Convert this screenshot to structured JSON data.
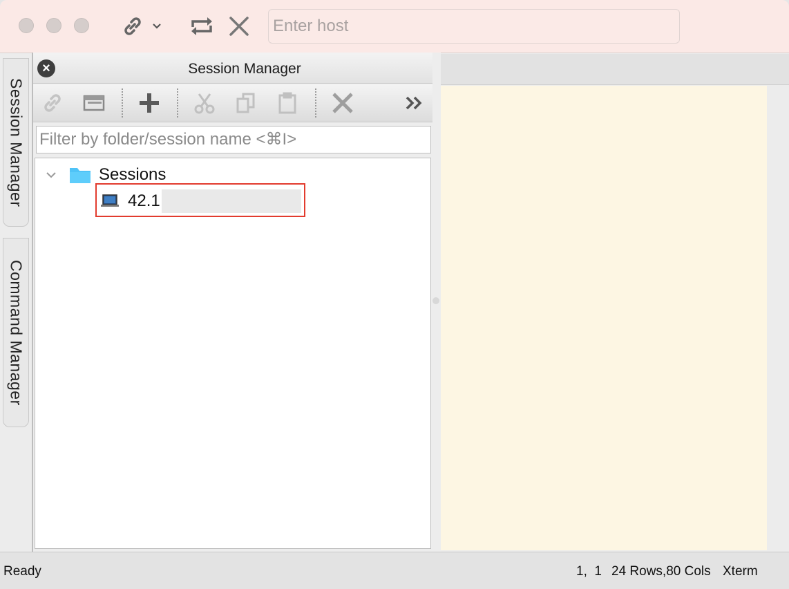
{
  "toolbar": {
    "host_placeholder": "Enter host",
    "icons": [
      "link-icon",
      "chevron-down-icon",
      "reconnect-icon",
      "close-icon"
    ]
  },
  "side_tabs": [
    "Session Manager",
    "Command Manager"
  ],
  "session_manager": {
    "title": "Session Manager",
    "toolbar_icons": [
      "connect-icon",
      "open-tab-icon",
      "add-icon",
      "cut-icon",
      "copy-icon",
      "paste-icon",
      "delete-icon",
      "more-icon"
    ],
    "filter_placeholder": "Filter by folder/session name <⌘I>",
    "folder": "Sessions",
    "session_label": "42.1"
  },
  "status": {
    "left": "Ready",
    "position": "1,  1",
    "size": "24 Rows,80 Cols",
    "terminal_type": "Xterm"
  },
  "colors": {
    "terminal_bg": "#fdf6e3",
    "titlebar_bg": "#fbe9e6",
    "highlight": "#e23b2e",
    "folder": "#4fc3f7"
  }
}
